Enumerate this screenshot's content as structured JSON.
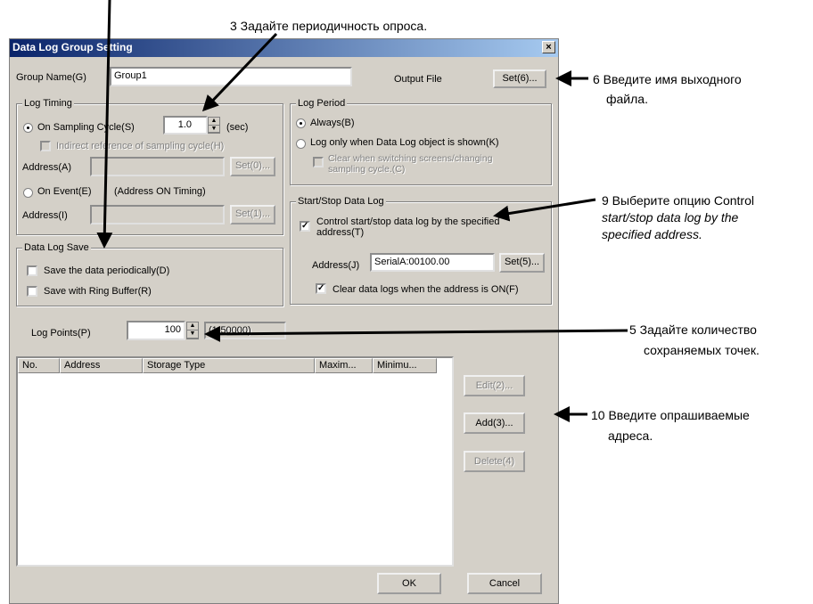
{
  "annotations": {
    "step3": "3 Задайте периодичность опроса.",
    "step6_line1": "6 Введите имя выходного",
    "step6_line2": "файла.",
    "step9_line1": "9 Выберите опцию Control",
    "step9_line2": "start/stop data log by the",
    "step9_line3": "specified address.",
    "step5_line1": "5 Задайте количество",
    "step5_line2": "сохраняемых точек.",
    "step10_line1": "10 Введите опрашиваемые",
    "step10_line2": "адреса."
  },
  "dialog": {
    "title": "Data Log Group Setting",
    "close": "×",
    "group_name_label": "Group Name(G)",
    "group_name_value": "Group1",
    "output_file_label": "Output File",
    "set6": "Set(6)...",
    "log_timing": {
      "caption": "Log Timing",
      "on_sampling": "On Sampling Cycle(S)",
      "cycle_value": "1.0",
      "sec": "(sec)",
      "indirect": "Indirect reference of sampling cycle(H)",
      "address_a": "Address(A)",
      "set0": "Set(0)...",
      "on_event": "On Event(E)",
      "on_event_note": "(Address ON Timing)",
      "address_i": "Address(I)",
      "set1": "Set(1)..."
    },
    "log_period": {
      "caption": "Log Period",
      "always": "Always(B)",
      "only_shown": "Log only when Data Log object is shown(K)",
      "clear_switch_1": "Clear when switching screens/changing",
      "clear_switch_2": "sampling cycle.(C)"
    },
    "start_stop": {
      "caption": "Start/Stop Data Log",
      "control_1": "Control start/stop data log by the specified",
      "control_2": "address(T)",
      "address_label": "Address(J)",
      "address_value": "SerialA:00100.00",
      "set5": "Set(5)...",
      "clear_on": "Clear data logs when the address is ON(F)"
    },
    "save": {
      "caption": "Data Log Save",
      "periodic": "Save the data periodically(D)",
      "ring": "Save with Ring Buffer(R)"
    },
    "log_points_label": "Log Points(P)",
    "log_points_value": "100",
    "log_points_range": "(1-50000)",
    "columns": [
      "No.",
      "Address",
      "Storage Type",
      "Maxim...",
      "Minimu..."
    ],
    "edit": "Edit(2)...",
    "add": "Add(3)...",
    "delete": "Delete(4)",
    "ok": "OK",
    "cancel": "Cancel"
  }
}
